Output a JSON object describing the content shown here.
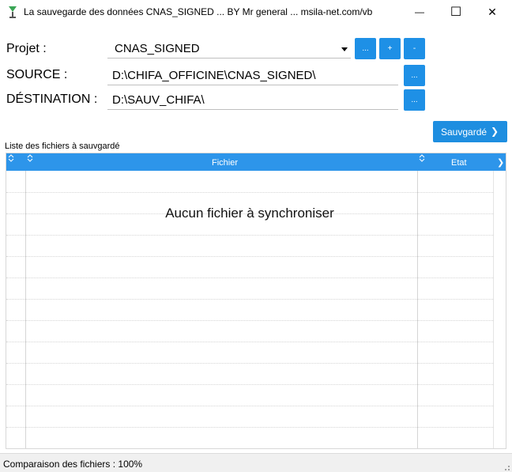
{
  "window": {
    "title": "La sauvegarde des données CNAS_SIGNED ... BY Mr general ... msila-net.com/vb",
    "minimize_glyph": "—",
    "maximize_glyph": "☐",
    "close_glyph": "✕"
  },
  "form": {
    "projet_label": "Projet :",
    "projet_value": "CNAS_SIGNED",
    "source_label": "SOURCE :",
    "source_value": "D:\\CHIFA_OFFICINE\\CNAS_SIGNED\\",
    "destination_label": "DÉSTINATION :",
    "destination_value": "D:\\SAUV_CHIFA\\",
    "browse_label": "...",
    "add_label": "+",
    "remove_label": "-"
  },
  "actions": {
    "save_label": "Sauvgardé",
    "save_chevron": "❯"
  },
  "grid": {
    "caption": "Liste des fichiers à sauvgardé",
    "columns": [
      "",
      "Fichier",
      "Etat"
    ],
    "empty_message": "Aucun fichier à synchroniser",
    "header_next": "❯"
  },
  "status": {
    "text": "Comparaison des fichiers : 100%"
  },
  "colors": {
    "accent": "#1e90e6",
    "header": "#2d95ea"
  }
}
